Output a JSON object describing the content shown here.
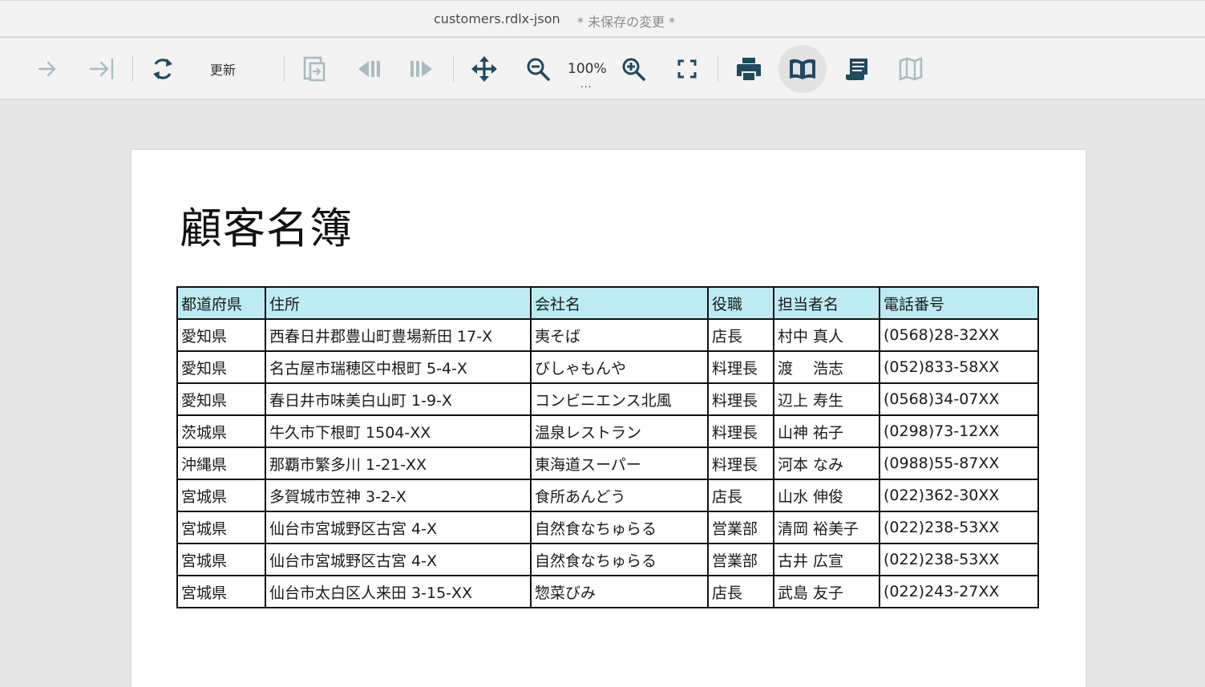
{
  "window": {
    "file_name": "customers.rdlx-json",
    "unsaved_label": "* 未保存の変更 *"
  },
  "toolbar": {
    "refresh_label": "更新",
    "zoom_value": "100%",
    "zoom_more": "...",
    "icons": [
      "arrow-right-icon",
      "arrow-to-end-icon",
      "refresh-icon",
      "export-icon",
      "prev-page-icon",
      "next-page-icon",
      "pan-icon",
      "zoom-out-icon",
      "zoom-in-icon",
      "fullscreen-icon",
      "print-icon",
      "book-icon",
      "scroll-icon",
      "map-icon"
    ],
    "active_item": "book-icon"
  },
  "report": {
    "title": "顧客名簿",
    "columns": [
      "都道府県",
      "住所",
      "会社名",
      "役職",
      "担当者名",
      "電話番号"
    ],
    "rows": [
      [
        "愛知県",
        "西春日井郡豊山町豊場新田 17-X",
        "夷そば",
        "店長",
        "村中 真人",
        "(0568)28-32XX"
      ],
      [
        "愛知県",
        "名古屋市瑞穂区中根町 5-4-X",
        "びしゃもんや",
        "料理長",
        "渡　 浩志",
        "(052)833-58XX"
      ],
      [
        "愛知県",
        "春日井市味美白山町 1-9-X",
        "コンビニエンス北風",
        "料理長",
        "辺上 寿生",
        "(0568)34-07XX"
      ],
      [
        "茨城県",
        "牛久市下根町 1504-XX",
        "温泉レストラン",
        "料理長",
        "山神 祐子",
        "(0298)73-12XX"
      ],
      [
        "沖縄県",
        "那覇市繁多川 1-21-XX",
        "東海道スーパー",
        "料理長",
        "河本 なみ",
        "(0988)55-87XX"
      ],
      [
        "宮城県",
        "多賀城市笠神 3-2-X",
        "食所あんどう",
        "店長",
        "山水 伸俊",
        "(022)362-30XX"
      ],
      [
        "宮城県",
        "仙台市宮城野区古宮 4-X",
        "自然食なちゅらる",
        "営業部",
        "清岡 裕美子",
        "(022)238-53XX"
      ],
      [
        "宮城県",
        "仙台市宮城野区古宮 4-X",
        "自然食なちゅらる",
        "営業部",
        "古井 広宣",
        "(022)238-53XX"
      ],
      [
        "宮城県",
        "仙台市太白区人来田 3-15-XX",
        "惣菜びみ",
        "店長",
        "武島 友子",
        "(022)243-27XX"
      ]
    ]
  },
  "colors": {
    "header_fill": "#bdebf2",
    "icon_disabled": "#a9bcc2",
    "icon_active": "#1f4a60"
  }
}
